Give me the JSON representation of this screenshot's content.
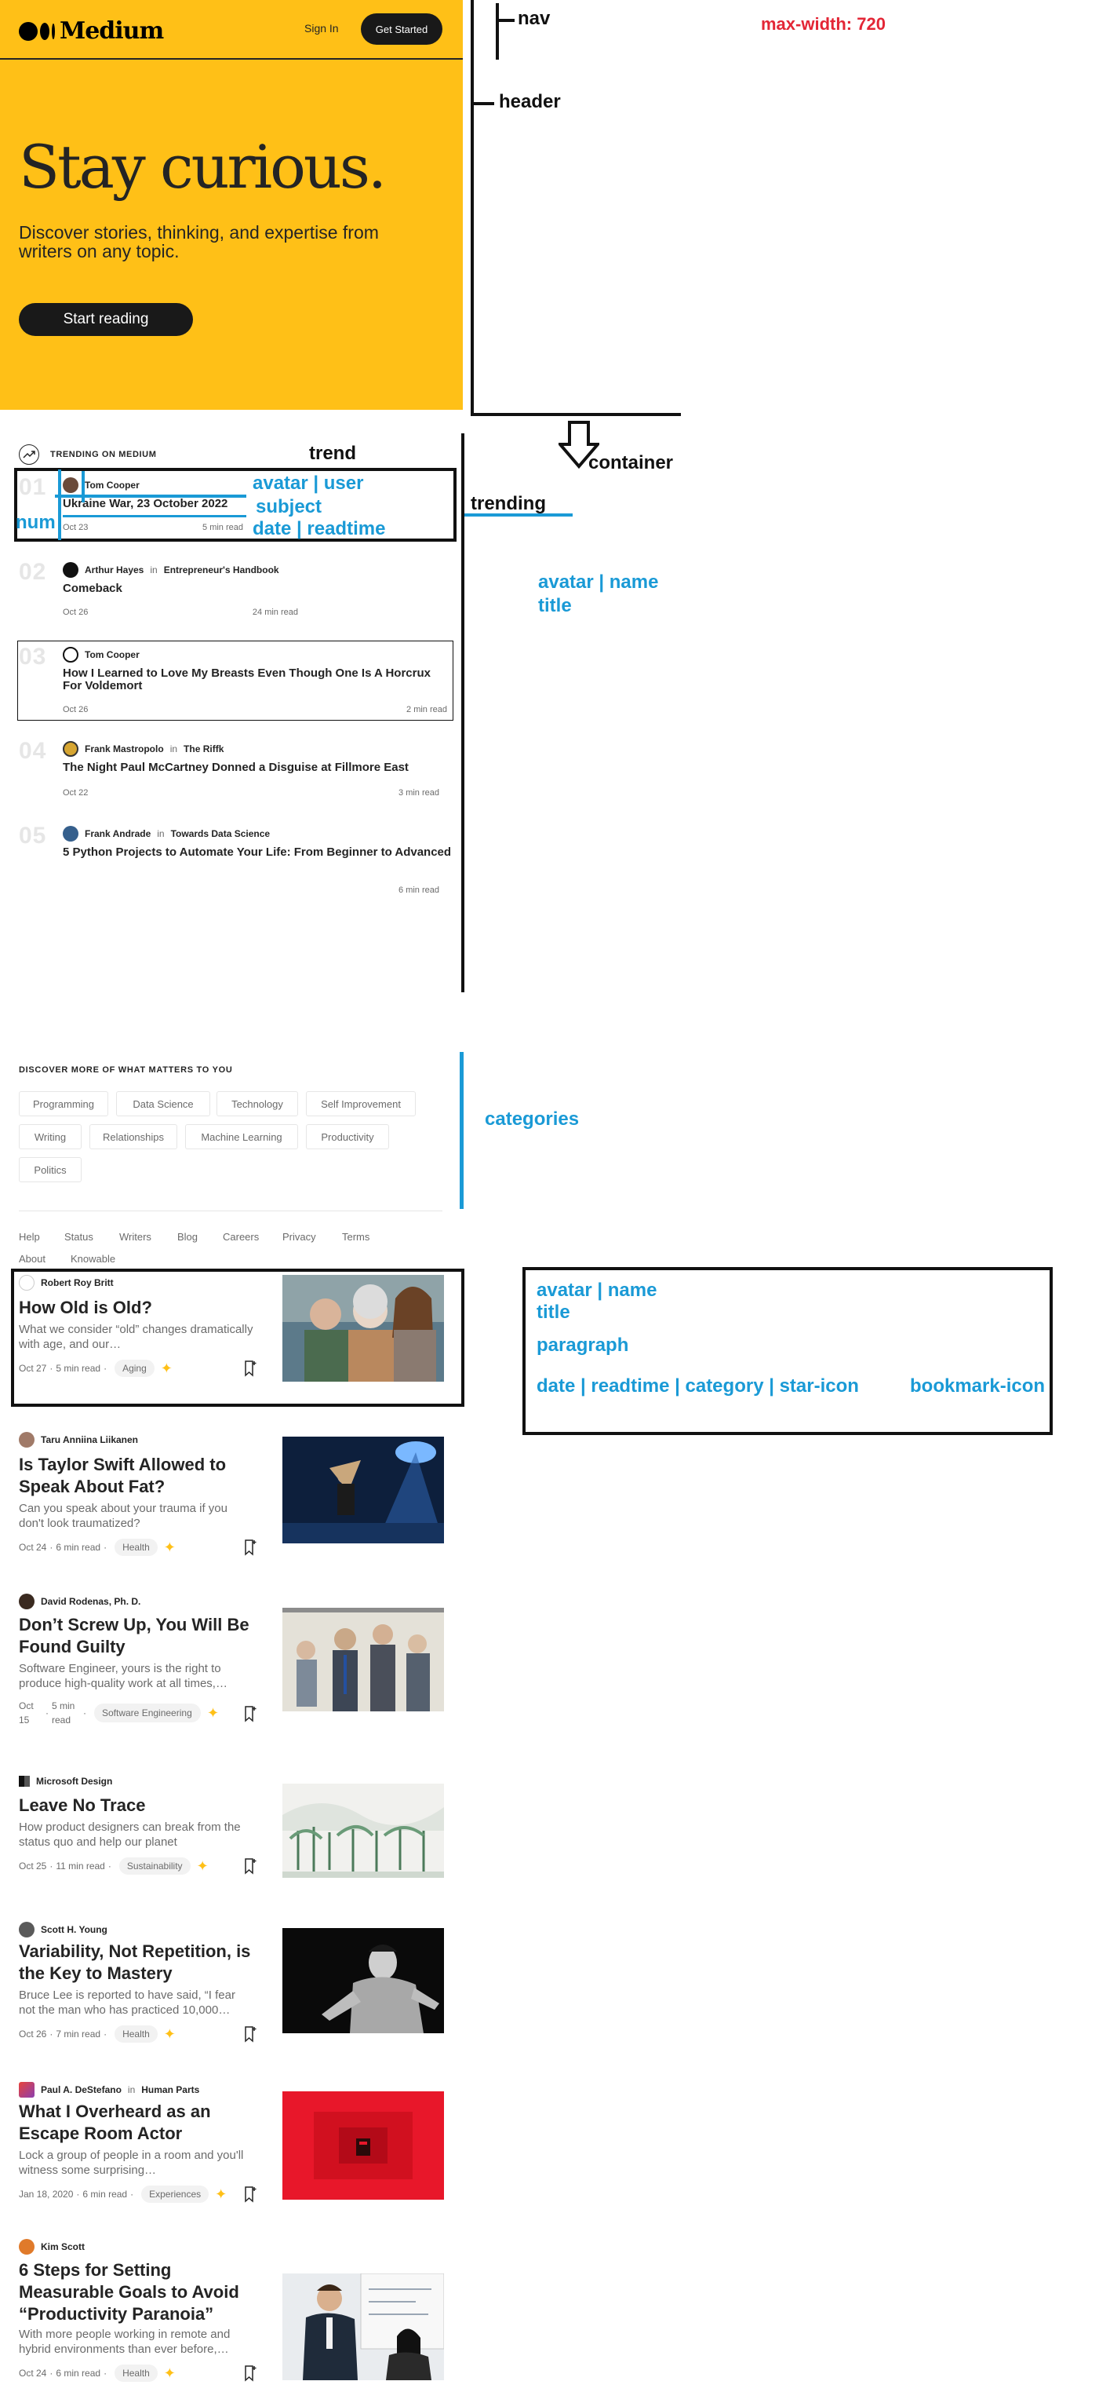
{
  "nav": {
    "logo_text": "Medium",
    "signin": "Sign In",
    "get_started": "Get Started"
  },
  "hero": {
    "title": "Stay curious.",
    "subtitle": "Discover stories, thinking, and expertise from writers on any topic.",
    "cta": "Start reading"
  },
  "trending": {
    "heading": "TRENDING ON MEDIUM",
    "items": [
      {
        "num": "01",
        "author": "Tom Cooper",
        "publication": "",
        "title": "Ukraine War, 23 October 2022",
        "date": "Oct 23",
        "readtime": "5 min read"
      },
      {
        "num": "02",
        "author": "Arthur Hayes",
        "publication": "Entrepreneur's Handbook",
        "title": "Comeback",
        "date": "Oct 26",
        "readtime": "24 min read"
      },
      {
        "num": "03",
        "author": "Tom Cooper",
        "publication": "",
        "title": "How I Learned to Love My Breasts Even Though One Is A Horcrux For Voldemort",
        "date": "Oct 26",
        "readtime": "2 min read"
      },
      {
        "num": "04",
        "author": "Frank Mastropolo",
        "publication": "The Riffk",
        "title": "The Night Paul McCartney Donned a Disguise at Fillmore East",
        "date": "Oct 22",
        "readtime": "3 min read"
      },
      {
        "num": "05",
        "author": "Frank Andrade",
        "publication": "Towards Data Science",
        "title": "5 Python Projects to Automate Your Life: From Beginner to Advanced",
        "date": "",
        "readtime": "6 min read"
      }
    ],
    "in_word": "in"
  },
  "discover": {
    "heading": "DISCOVER MORE OF WHAT MATTERS TO YOU",
    "chips": [
      "Programming",
      "Data Science",
      "Technology",
      "Self Improvement",
      "Writing",
      "Relationships",
      "Machine Learning",
      "Productivity",
      "Politics"
    ]
  },
  "footer": {
    "links": [
      "Help",
      "Status",
      "Writers",
      "Blog",
      "Careers",
      "Privacy",
      "Terms",
      "About",
      "Knowable"
    ]
  },
  "posts": [
    {
      "author": "Robert Roy Britt",
      "publication": "",
      "title": "How Old is Old?",
      "subtitle": "What we consider “old” changes dramatically with age, and our…",
      "date": "Oct 27",
      "readtime": "5 min read",
      "tag": "Aging"
    },
    {
      "author": "Taru Anniina Liikanen",
      "publication": "",
      "title": "Is Taylor Swift Allowed to Speak About Fat?",
      "subtitle": "Can you speak about your trauma if you don't look traumatized?",
      "date": "Oct 24",
      "readtime": "6 min read",
      "tag": "Health"
    },
    {
      "author": "David Rodenas, Ph. D.",
      "publication": "",
      "title": "Don’t Screw Up, You Will Be Found Guilty",
      "subtitle": "Software Engineer, yours is the right to produce high-quality work at all times,…",
      "date": "Oct 15",
      "readtime": "5 min read",
      "tag": "Software Engineering"
    },
    {
      "author": "Microsoft Design",
      "publication": "",
      "title": "Leave No Trace",
      "subtitle": "How product designers can break from the status quo and help our planet",
      "date": "Oct 25",
      "readtime": "11 min read",
      "tag": "Sustainability"
    },
    {
      "author": "Scott H. Young",
      "publication": "",
      "title": "Variability, Not Repetition, is the Key to Mastery",
      "subtitle": "Bruce Lee is reported to have said, “I fear not the man who has practiced 10,000…",
      "date": "Oct 26",
      "readtime": "7 min read",
      "tag": "Health"
    },
    {
      "author": "Paul A. DeStefano",
      "publication": "Human Parts",
      "title": "What I Overheard as an Escape Room Actor",
      "subtitle": "Lock a group of people in a room and you'll witness some surprising…",
      "date": "Jan 18, 2020",
      "readtime": "6 min read",
      "tag": "Experiences"
    },
    {
      "author": "Kim Scott",
      "publication": "",
      "title": "6 Steps for Setting Measurable Goals to Avoid “Productivity Paranoia”",
      "subtitle": "With more people working in remote and hybrid environments than ever before,…",
      "date": "Oct 24",
      "readtime": "6 min read",
      "tag": "Health"
    }
  ],
  "annotations": {
    "nav": "nav",
    "max_width": "max-width: 720",
    "header": "header",
    "container": "container",
    "trend": "trend",
    "avatar_user": "avatar | user",
    "subject": "subject",
    "date_readtime": "date | readtime",
    "num": "num",
    "trending": "trending",
    "avatar_name": "avatar | name",
    "title": "title",
    "categories": "categories",
    "card_avatar_name": "avatar | name",
    "card_title": "title",
    "paragraph": "paragraph",
    "card_meta": "date | readtime  | category | star-icon",
    "bookmark_icon": "bookmark-icon"
  },
  "colors": {
    "brand_yellow": "#ffc017",
    "annotation_blue": "#1a9ad6",
    "annotation_red": "#e32636"
  }
}
